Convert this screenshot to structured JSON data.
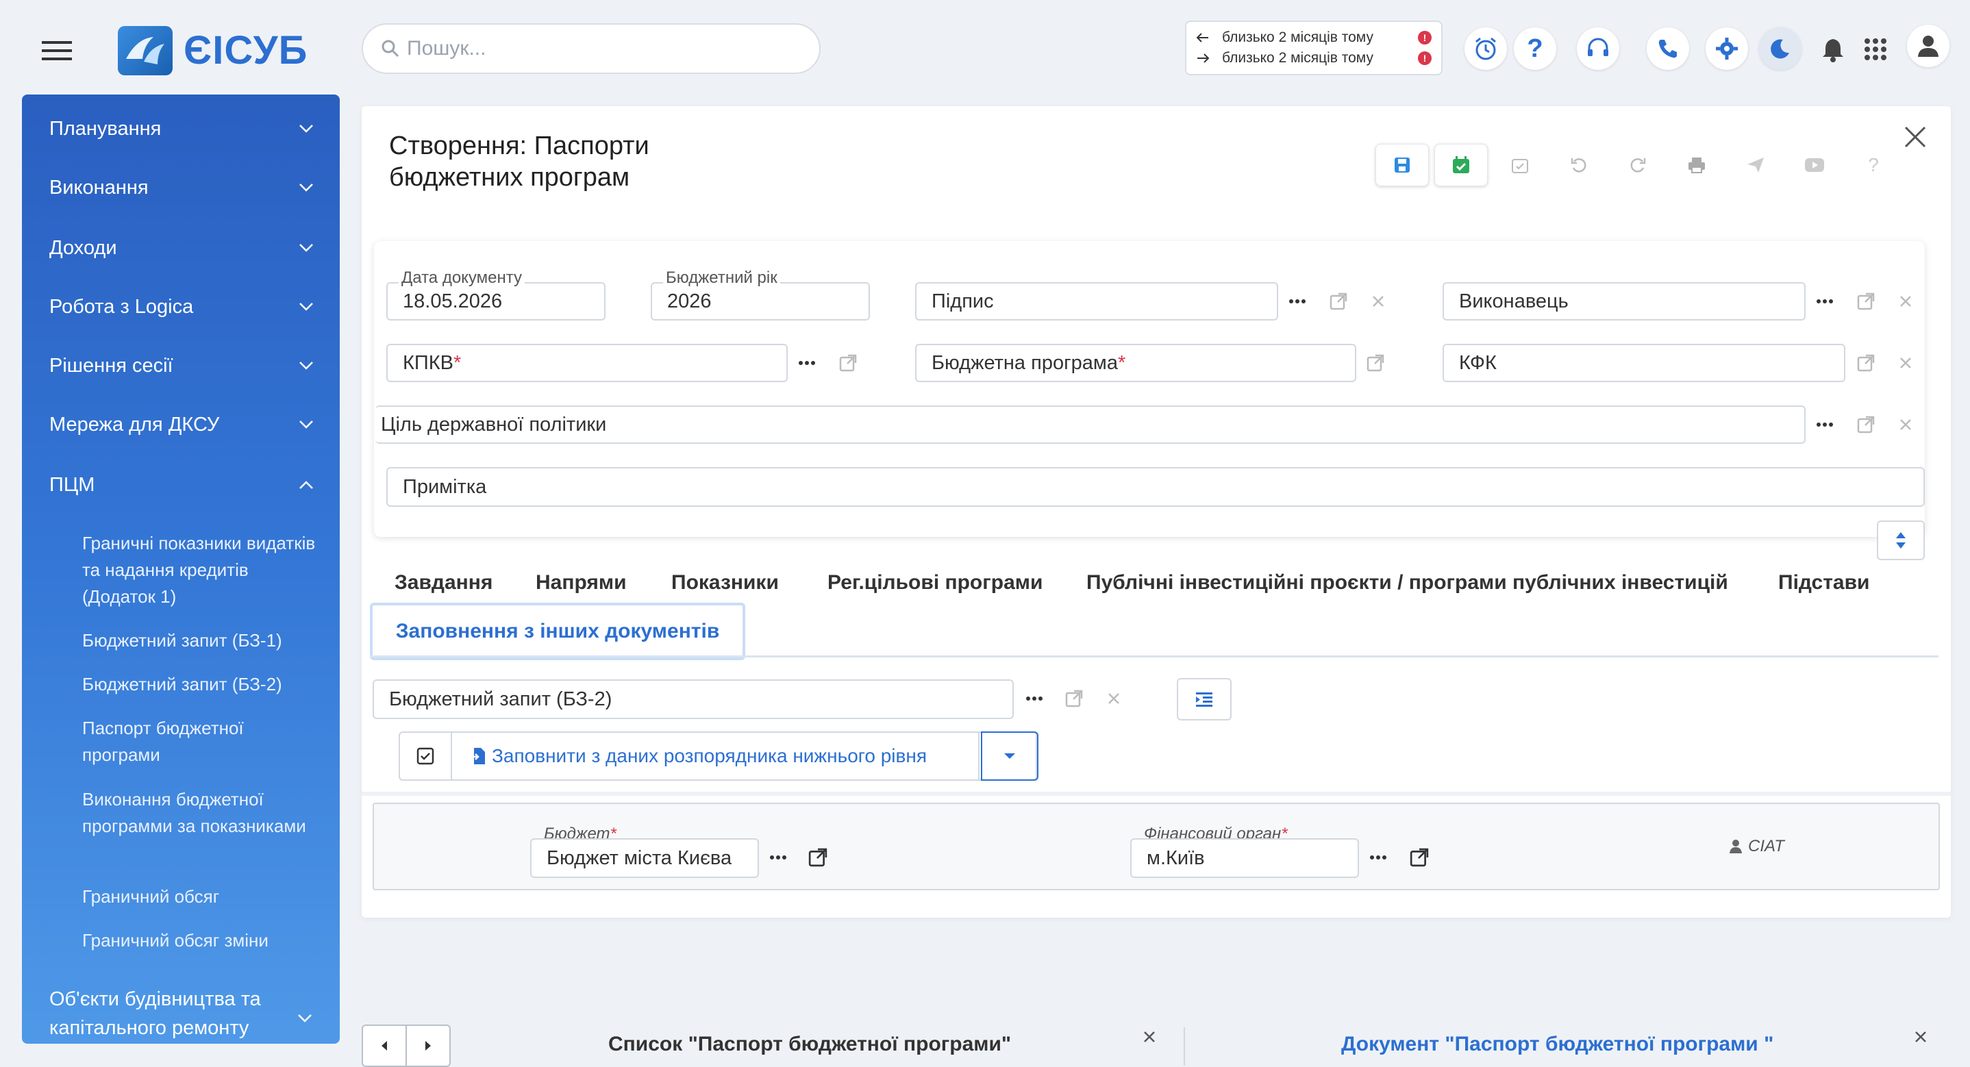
{
  "header": {
    "logo_text": "ЄІСУБ",
    "search_placeholder": "Пошук...",
    "history": [
      {
        "text": "близько 2 місяців тому",
        "badge": "!"
      },
      {
        "text": "близько 2 місяців тому",
        "badge": "!"
      }
    ],
    "icons": [
      "alarm-clock-icon",
      "help-icon",
      "headset-icon",
      "phone-icon",
      "settings-icon",
      "moon-icon",
      "bell-icon",
      "apps-grid-icon",
      "user-icon"
    ]
  },
  "sidebar": {
    "items": [
      {
        "label": "Планування"
      },
      {
        "label": "Виконання"
      },
      {
        "label": "Доходи"
      },
      {
        "label": "Робота з Logica"
      },
      {
        "label": "Рішення сесії"
      },
      {
        "label": "Мережа для ДКСУ"
      },
      {
        "label": "ПЦМ"
      }
    ],
    "subitems": [
      "Граничні показники видатків та надання кредитів (Додаток 1)",
      "Бюджетний запит (БЗ-1)",
      "Бюджетний запит (БЗ-2)",
      "Паспорт бюджетної програми",
      "Виконання бюджетної программи за показниками",
      "Граничний обсяг",
      "Граничний обсяг зміни"
    ],
    "last_item": "Об'єкти будівництва та капітального ремонту"
  },
  "document": {
    "title_line1": "Створення: Паспорти",
    "title_line2": "бюджетних програм",
    "fields": {
      "doc_date_label": "Дата документу",
      "doc_date_value": "18.05.2026",
      "budget_year_label": "Бюджетний рік",
      "budget_year_value": "2026",
      "signature": "Підпис",
      "executor": "Виконавець",
      "kpkv": "КПКВ",
      "budget_program": "Бюджетна програма",
      "kfk": "КФК",
      "policy_goal": "Ціль державної політики",
      "note": "Примітка"
    },
    "tabs": [
      "Завдання",
      "Напрями",
      "Показники",
      "Рег.цільові програми",
      "Публічні інвестиційні проєкти / програми публічних інвестицій",
      "Підстави"
    ],
    "active_tab": "Заповнення з інших документів",
    "source_doc": "Бюджетний запит (БЗ-2)",
    "fill_button": "Заповнити з даних розпорядника нижнього рівня",
    "budget_label": "Бюджет",
    "budget_value": "Бюджет міста Києва",
    "fin_org_label": "Фінансовий орган",
    "fin_org_value": "м.Київ",
    "user_tag": "CIAT"
  },
  "bottom_tabs": {
    "left": "Список \"Паспорт бюджетної програми\"",
    "right": "Документ \"Паспорт бюджетної програми \""
  },
  "colors": {
    "accent": "#2c6fd1",
    "required": "#d9374b",
    "sidebar_top": "#2a5fc0",
    "sidebar_bottom": "#4f99e8"
  }
}
